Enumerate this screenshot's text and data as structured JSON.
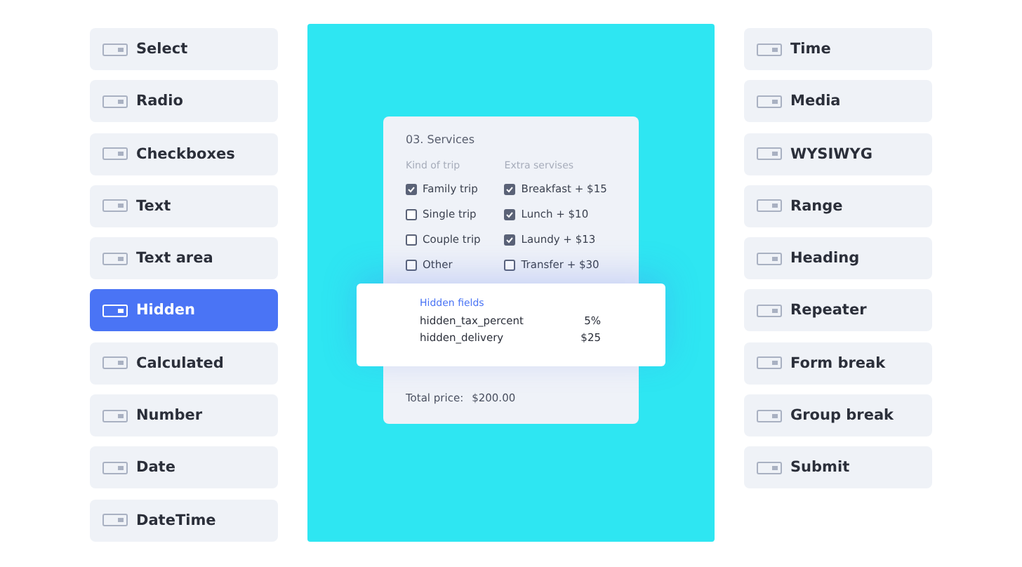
{
  "left_items": [
    {
      "label": "Select",
      "selected": false
    },
    {
      "label": "Radio",
      "selected": false
    },
    {
      "label": "Checkboxes",
      "selected": false
    },
    {
      "label": "Text",
      "selected": false
    },
    {
      "label": "Text area",
      "selected": false
    },
    {
      "label": "Hidden",
      "selected": true
    },
    {
      "label": "Calculated",
      "selected": false
    },
    {
      "label": "Number",
      "selected": false
    },
    {
      "label": "Date",
      "selected": false
    },
    {
      "label": "DateTime",
      "selected": false
    }
  ],
  "right_items": [
    {
      "label": "Time",
      "selected": false
    },
    {
      "label": "Media",
      "selected": false
    },
    {
      "label": "WYSIWYG",
      "selected": false
    },
    {
      "label": "Range",
      "selected": false
    },
    {
      "label": "Heading",
      "selected": false
    },
    {
      "label": "Repeater",
      "selected": false
    },
    {
      "label": "Form break",
      "selected": false
    },
    {
      "label": "Group break",
      "selected": false
    },
    {
      "label": "Submit",
      "selected": false
    }
  ],
  "form": {
    "title": "03. Services",
    "columns": [
      {
        "heading": "Kind of trip",
        "options": [
          {
            "label": "Family trip",
            "checked": true
          },
          {
            "label": "Single trip",
            "checked": false
          },
          {
            "label": "Couple trip",
            "checked": false
          },
          {
            "label": "Other",
            "checked": false
          }
        ]
      },
      {
        "heading": "Extra servises",
        "options": [
          {
            "label": "Breakfast + $15",
            "checked": true
          },
          {
            "label": "Lunch + $10",
            "checked": true
          },
          {
            "label": "Laundy + $13",
            "checked": true
          },
          {
            "label": "Transfer + $30",
            "checked": false
          }
        ]
      }
    ],
    "hidden": {
      "title": "Hidden fields",
      "rows": [
        {
          "name": "hidden_tax_percent",
          "value": "5%"
        },
        {
          "name": "hidden_delivery",
          "value": "$25"
        }
      ]
    },
    "total_label": "Total price:",
    "total_value": "$200.00"
  }
}
